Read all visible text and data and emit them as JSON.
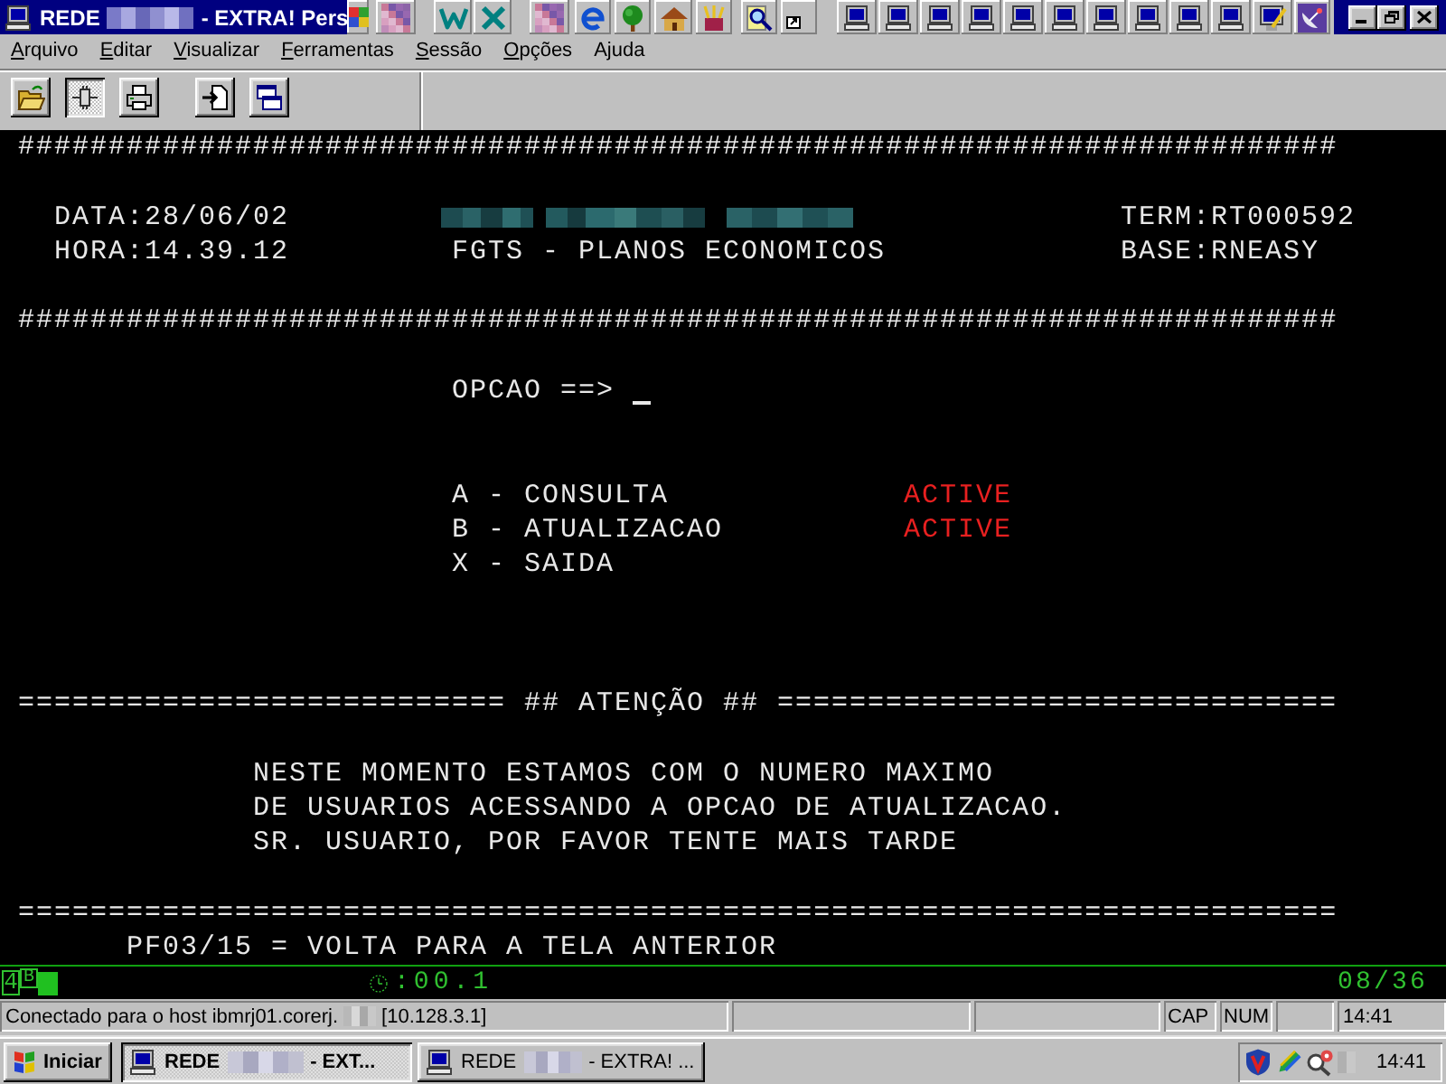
{
  "window": {
    "title_start": "REDE",
    "title_end": "- EXTRA! Pers"
  },
  "menu": [
    {
      "access_key": "A",
      "text_after": "rquivo"
    },
    {
      "access_key": "E",
      "text_after": "ditar"
    },
    {
      "access_key": "V",
      "text_after": "isualizar"
    },
    {
      "access_key": "F",
      "text_after": "erramentas"
    },
    {
      "access_key": "S",
      "text_after": "essão"
    },
    {
      "access_key": "O",
      "text_after": "pções"
    },
    {
      "text_before": "A",
      "access_key": "j",
      "text_after": "uda"
    }
  ],
  "toolbar": {
    "groups": [
      {
        "buttons": [
          {
            "kind": "open",
            "pressed": false
          },
          {
            "kind": "connect",
            "pressed": true
          },
          {
            "kind": "print",
            "pressed": false
          }
        ]
      },
      {
        "buttons": [
          {
            "kind": "transfer",
            "pressed": false
          },
          {
            "kind": "windows",
            "pressed": false
          }
        ]
      }
    ]
  },
  "screen": {
    "top_border": "#########################################################################",
    "header": {
      "date": "DATA:28/06/02",
      "time": "HORA:14.39.12",
      "system": "FGTS - PLANOS ECONOMICOS",
      "terminal": "TERM:RT000592",
      "base": "BASE:RNEASY"
    },
    "header_border": "#########################################################################",
    "prompt": "OPCAO ==>",
    "options": [
      {
        "label": "A - CONSULTA",
        "status": "ACTIVE"
      },
      {
        "label": "B - ATUALIZACAO",
        "status": "ACTIVE"
      },
      {
        "label": "X - SAIDA"
      }
    ],
    "notice": {
      "rule_left": "===========================",
      "heading": "## ATENÇÃO ##",
      "rule_right": "===============================",
      "lines": [
        "NESTE MOMENTO ESTAMOS COM O NUMERO MAXIMO",
        "DE USUARIOS ACESSANDO A OPCAO DE ATUALIZACAO.",
        "SR. USUARIO, POR FAVOR TENTE MAIS TARDE"
      ]
    },
    "bottom_border": "=========================================================================",
    "function_keys": "PF03/15 = VOLTA PARA A TELA ANTERIOR"
  },
  "oia": {
    "indicators": [
      "4",
      "B"
    ],
    "timer": ":00.1",
    "cursor_position": "08/36"
  },
  "status_bar": {
    "message_start": "Conectado para o host ibmrj01.corerj.",
    "message_end": "[10.128.3.1]",
    "indicators": [
      "CAP",
      "NUM"
    ],
    "clock": "14:41"
  },
  "taskbar": {
    "start_label": "Iniciar",
    "tasks": [
      {
        "title_start": "REDE",
        "title_end": "- EXT...",
        "selected": true
      },
      {
        "title_start": "REDE",
        "title_end": "- EXTRA! ...",
        "selected": false
      }
    ],
    "clock": "14:41"
  }
}
